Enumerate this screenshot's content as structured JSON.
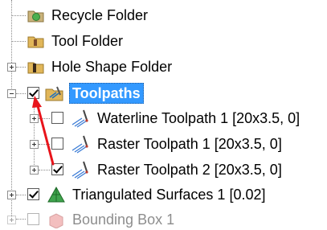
{
  "tree": {
    "items": [
      {
        "label": "Recycle Folder",
        "icon": "recycle-folder-icon"
      },
      {
        "label": "Tool Folder",
        "icon": "tool-folder-icon"
      },
      {
        "label": "Hole Shape Folder",
        "icon": "hole-shape-folder-icon",
        "expander": "plus"
      },
      {
        "label": "Toolpaths",
        "icon": "toolpaths-folder-icon",
        "expander": "minus",
        "checked": true,
        "selected": true
      },
      {
        "label": "Waterline Toolpath 1 [20x3.5, 0]",
        "icon": "waterline-toolpath-icon",
        "expander": "plus",
        "checked": false
      },
      {
        "label": "Raster Toolpath 1 [20x3.5, 0]",
        "icon": "raster-toolpath-icon",
        "expander": "plus",
        "checked": false
      },
      {
        "label": "Raster Toolpath 2 [20x3.5, 0]",
        "icon": "raster-toolpath-icon",
        "expander": "plus",
        "checked": true
      },
      {
        "label": "Triangulated Surfaces 1 [0.02]",
        "icon": "triangulated-surfaces-icon",
        "expander": "plus",
        "checked": true
      },
      {
        "label": "Bounding Box 1",
        "icon": "bounding-box-icon",
        "expander": "plus",
        "checked": false
      }
    ]
  },
  "annotation": {
    "arrow_color": "#e8141b"
  },
  "colors": {
    "selection": "#3399ff",
    "folder": "#d7a94a"
  }
}
